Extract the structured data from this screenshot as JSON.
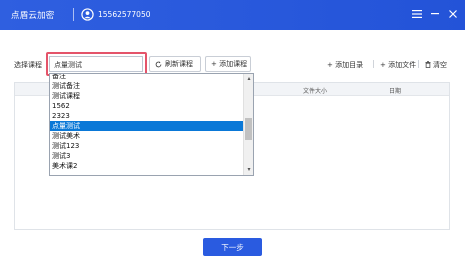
{
  "window": {
    "title": "点盾云加密",
    "user_phone": "15562577050",
    "icons": {
      "user": "user-circle-icon",
      "menu": "hamburger-menu-icon",
      "minimize": "minimize-icon",
      "close": "close-icon"
    }
  },
  "toolbar": {
    "select_label": "选择课程",
    "selected_course": "点量测试",
    "refresh_label": "刷新课程",
    "add_course_label": "+ 添加课程",
    "add_dir_label": "+ 添加目录",
    "add_file_label": "+ 添加文件",
    "clear_label": "清空"
  },
  "table": {
    "columns": [
      "文件大小",
      "日期"
    ]
  },
  "dropdown": {
    "items": [
      "备注",
      "测试备注",
      "测试课程",
      "1562",
      "2323",
      "点量测试",
      "测试美术",
      "测试123",
      "测试3",
      "美术课2"
    ],
    "selected_index": 5
  },
  "footer": {
    "next_label": "下一步"
  },
  "colors": {
    "titlebar": "#2353d8",
    "highlight": "#e4546a",
    "selected": "#0a78d7",
    "primary_button": "#2a5be0"
  }
}
